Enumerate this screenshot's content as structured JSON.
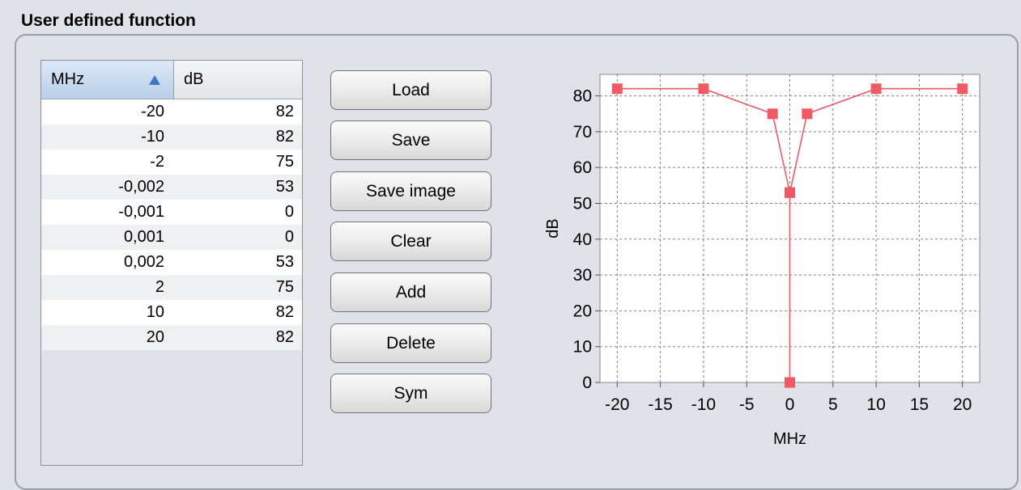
{
  "panel": {
    "title": "User defined function"
  },
  "table": {
    "columns": [
      "MHz",
      "dB"
    ],
    "sorted_column": "MHz",
    "sort_direction": "ascending",
    "rows": [
      {
        "mhz": "-20",
        "db": "82"
      },
      {
        "mhz": "-10",
        "db": "82"
      },
      {
        "mhz": "-2",
        "db": "75"
      },
      {
        "mhz": "-0,002",
        "db": "53"
      },
      {
        "mhz": "-0,001",
        "db": "0"
      },
      {
        "mhz": "0,001",
        "db": "0"
      },
      {
        "mhz": "0,002",
        "db": "53"
      },
      {
        "mhz": "2",
        "db": "75"
      },
      {
        "mhz": "10",
        "db": "82"
      },
      {
        "mhz": "20",
        "db": "82"
      }
    ]
  },
  "buttons": {
    "load": "Load",
    "save": "Save",
    "save_image": "Save image",
    "clear": "Clear",
    "add": "Add",
    "delete": "Delete",
    "sym": "Sym"
  },
  "chart_data": {
    "type": "line",
    "xlabel": "MHz",
    "ylabel": "dB",
    "xlim": [
      -22,
      22
    ],
    "ylim": [
      0,
      86
    ],
    "xticks": [
      -20,
      -15,
      -10,
      -5,
      0,
      5,
      10,
      15,
      20
    ],
    "yticks": [
      0,
      10,
      20,
      30,
      40,
      50,
      60,
      70,
      80
    ],
    "grid": true,
    "series": [
      {
        "color": "#f05a64",
        "x": [
          -20,
          -10,
          -2,
          -0.002,
          -0.001,
          0.001,
          0.002,
          2,
          10,
          20
        ],
        "y": [
          82,
          82,
          75,
          53,
          0,
          0,
          53,
          75,
          82,
          82
        ]
      }
    ]
  }
}
